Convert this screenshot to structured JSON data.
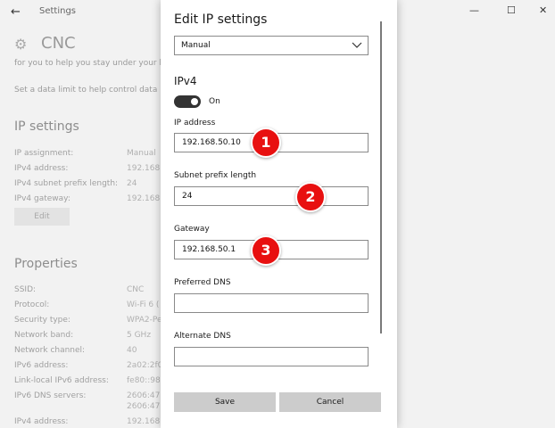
{
  "window": {
    "back_glyph": "←",
    "title": "Settings",
    "min_glyph": "—",
    "max_glyph": "☐",
    "close_glyph": "✕"
  },
  "background": {
    "network_name": "CNC",
    "faded_line_1": "for you to help you stay under your li",
    "faded_line_2": "Set a data limit to help control data us",
    "ip_settings": {
      "heading": "IP settings",
      "rows": [
        {
          "label": "IP assignment:",
          "value": "Manual"
        },
        {
          "label": "IPv4 address:",
          "value": "192.168.5"
        },
        {
          "label": "IPv4 subnet prefix length:",
          "value": "24"
        },
        {
          "label": "IPv4 gateway:",
          "value": "192.168.5"
        }
      ],
      "edit_label": "Edit"
    },
    "properties": {
      "heading": "Properties",
      "rows": [
        {
          "label": "SSID:",
          "value": "CNC"
        },
        {
          "label": "Protocol:",
          "value": "Wi-Fi 6 ("
        },
        {
          "label": "Security type:",
          "value": "WPA2-Pe"
        },
        {
          "label": "Network band:",
          "value": "5 GHz"
        },
        {
          "label": "Network channel:",
          "value": "40"
        },
        {
          "label": "IPv6 address:",
          "value": "2a02:2f0"
        },
        {
          "label": "Link-local IPv6 address:",
          "value": "fe80::981"
        },
        {
          "label": "IPv6 DNS servers:",
          "value": "2606:470"
        },
        {
          "label": "",
          "value": "2606:470"
        },
        {
          "label": "IPv4 address:",
          "value": "192.168.5"
        }
      ]
    }
  },
  "dialog": {
    "title": "Edit IP settings",
    "mode_value": "Manual",
    "ipv4_heading": "IPv4",
    "toggle_label": "On",
    "fields": {
      "ip_address": {
        "label": "IP address",
        "value": "192.168.50.10"
      },
      "subnet": {
        "label": "Subnet prefix length",
        "value": "24"
      },
      "gateway": {
        "label": "Gateway",
        "value": "192.168.50.1"
      },
      "preferred_dns": {
        "label": "Preferred DNS",
        "value": ""
      },
      "alternate_dns": {
        "label": "Alternate DNS",
        "value": ""
      }
    },
    "save_label": "Save",
    "cancel_label": "Cancel"
  },
  "markers": [
    "1",
    "2",
    "3"
  ],
  "colors": {
    "marker": "#e81010",
    "toggle": "#333333"
  }
}
